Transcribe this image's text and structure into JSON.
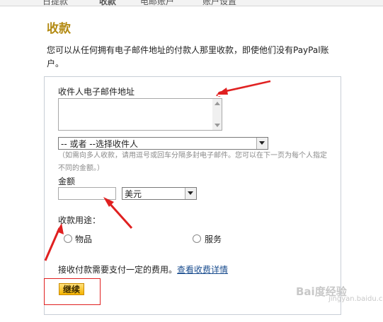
{
  "topbar": {
    "tabs": [
      "日提款",
      "收款",
      "电邮账户",
      "账户设置"
    ]
  },
  "page": {
    "title": "收款",
    "intro": "您可以从任何拥有电子邮件地址的付款人那里收款，即使他们没有PayPal账户。"
  },
  "form": {
    "email_label": "收件人电子邮件地址",
    "email_value": "",
    "recipient_select": "-- 或者 --选择收件人",
    "hint": "（如需向多人收款，请用逗号或回车分隔多封电子邮件。您可以在下一页为每个人指定不同的金额。）",
    "amount_label": "金额",
    "amount_value": "",
    "currency_select": "美元",
    "purpose_label": "收款用途：",
    "purpose_options": [
      "物品",
      "服务"
    ],
    "fee_text": "接收付款需要支付一定的费用。",
    "fee_link": "查看收费详情",
    "continue_label": "继续"
  },
  "watermark": {
    "text": "Bai度经验",
    "sub": "jingyan.baidu.com"
  },
  "colors": {
    "title": "#b38a12",
    "annotation": "#e02020",
    "button": "#f5b400",
    "link": "#1a4d8f"
  }
}
